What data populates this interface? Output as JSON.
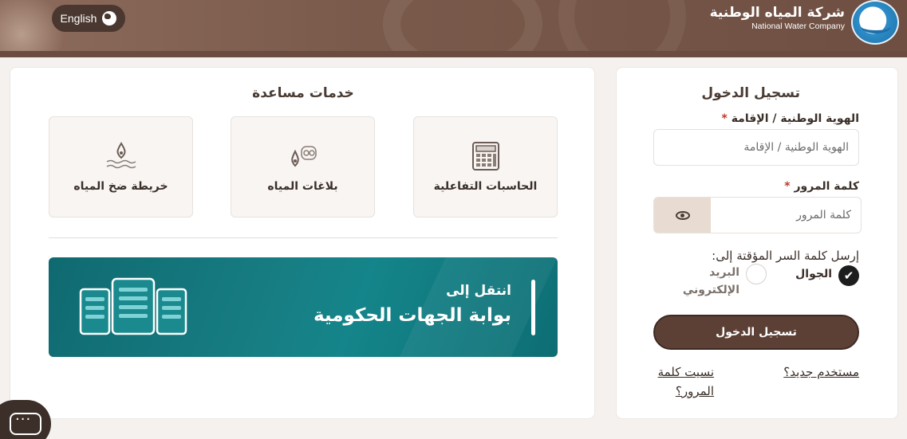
{
  "header": {
    "language_button": "English",
    "company_name_ar": "شركة المياه الوطنية",
    "company_name_en": "National Water Company"
  },
  "login": {
    "title": "تسجيل الدخول",
    "id_label": "الهوية الوطنية / الإقامة",
    "id_placeholder": "الهوية الوطنية / الإقامة",
    "password_label": "كلمة المرور",
    "password_placeholder": "كلمة المرور",
    "required_mark": "*",
    "otp_label": "إرسل كلمة السر المؤقتة إلى:",
    "otp_options": [
      {
        "label": "الجوال",
        "selected": true
      },
      {
        "label": "البريد الإلكتروني",
        "selected": false
      }
    ],
    "submit_label": "تسجيل الدخول",
    "new_user_link": "مستخدم جديد؟",
    "forgot_password_link": "نسيت كلمة المرور؟"
  },
  "services": {
    "title": "خدمات مساعدة",
    "cards": [
      {
        "label": "الحاسبات التفاعلية",
        "icon": "calculator-icon"
      },
      {
        "label": "بلاغات المياه",
        "icon": "water-report-icon"
      },
      {
        "label": "خريطة ضخ المياه",
        "icon": "water-map-icon"
      }
    ],
    "banner": {
      "small_text": "انتقل إلى",
      "big_text": "بوابة الجهات الحكومية"
    }
  },
  "colors": {
    "brand_brown": "#5c4036",
    "header_brown": "#7a5a4b",
    "banner_teal": "#177e84",
    "required_red": "#c0392b"
  }
}
